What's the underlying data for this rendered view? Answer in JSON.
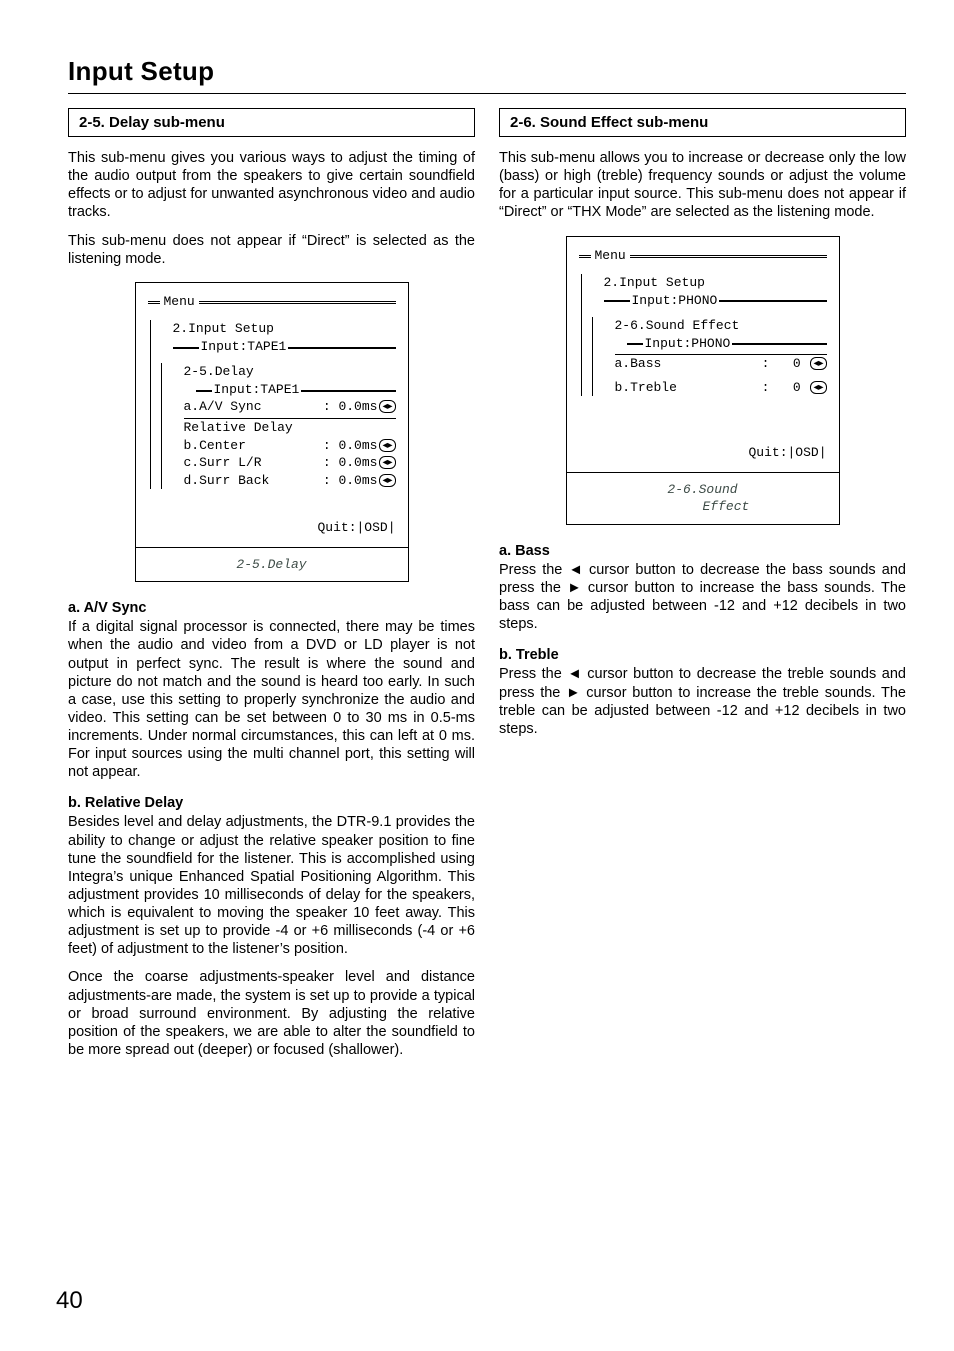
{
  "page": {
    "number": "40",
    "title": "Input Setup"
  },
  "left": {
    "header": "2-5. Delay sub-menu",
    "intro1": "This sub-menu gives you various ways to adjust the timing of the audio output from the speakers to give certain soundfield effects or to adjust for unwanted asynchronous video and audio tracks.",
    "intro2": "This sub-menu does not appear if “Direct” is selected as the listening mode.",
    "osd": {
      "menu": "Menu",
      "crumb1": "2.Input Setup",
      "crumb1_input": "Input:TAPE1",
      "crumb2": "2-5.Delay",
      "crumb2_input": "Input:TAPE1",
      "rows": {
        "av": {
          "label": "a.A/V Sync",
          "val": "0.0ms"
        },
        "rel_title": "Relative Delay",
        "center": {
          "label": "b.Center",
          "val": "0.0ms"
        },
        "surr": {
          "label": "c.Surr L/R",
          "val": "0.0ms"
        },
        "back": {
          "label": "d.Surr Back",
          "val": "0.0ms"
        }
      },
      "quit": "Quit:|OSD|",
      "caption": "2-5.Delay"
    },
    "a": {
      "title": "a. A/V Sync",
      "body": "If a digital signal processor is connected, there may be times when the audio and video from a DVD or LD player is not output in perfect sync. The result is where the sound and picture do not match and the sound is heard too early. In such a case, use this setting to properly synchronize the audio and video. This setting can be set between 0 to 30 ms in 0.5-ms increments. Under normal circumstances, this can left at 0 ms. For input sources using the multi channel port, this setting will not appear."
    },
    "b": {
      "title": "b. Relative Delay",
      "body1": "Besides level and delay adjustments, the DTR-9.1 provides the ability to change or adjust the relative speaker position to fine tune the soundfield for the listener. This is accomplished using Integra’s unique Enhanced Spatial Positioning Algorithm. This adjustment provides 10 milliseconds of delay for the speakers, which is equivalent to moving the speaker 10 feet away. This adjustment is set up to provide -4 or +6 milliseconds (-4 or +6 feet) of adjustment to the listener’s position.",
      "body2": "Once the coarse adjustments-speaker level and distance adjustments-are made, the system is set up to provide a typical or broad surround environment. By adjusting the relative position of the speakers, we are able to alter the soundfield to be more spread out (deeper) or focused (shallower)."
    }
  },
  "right": {
    "header": "2-6. Sound Effect sub-menu",
    "intro": "This sub-menu allows you to increase or decrease only the low (bass) or high (treble) frequency sounds or adjust the volume for a particular input source. This sub-menu does not appear if “Direct” or “THX Mode” are selected as the listening mode.",
    "osd": {
      "menu": "Menu",
      "crumb1": "2.Input Setup",
      "crumb1_input": "Input:PHONO",
      "crumb2": "2-6.Sound Effect",
      "crumb2_input": "Input:PHONO",
      "rows": {
        "bass": {
          "label": "a.Bass",
          "sep": ":",
          "val": "0"
        },
        "treble": {
          "label": "b.Treble",
          "sep": ":",
          "val": "0"
        }
      },
      "quit": "Quit:|OSD|",
      "caption": "2-6.Sound\n      Effect"
    },
    "a": {
      "title": "a. Bass",
      "body": "Press the ◄ cursor button to decrease the bass sounds and press the ► cursor button to increase the bass sounds. The bass can be adjusted between -12 and +12 decibels in two steps."
    },
    "b": {
      "title": "b. Treble",
      "body": "Press the ◄ cursor button to decrease the treble sounds and press the ► cursor button to increase the treble sounds. The treble can be adjusted between -12 and +12 decibels in two steps."
    }
  }
}
